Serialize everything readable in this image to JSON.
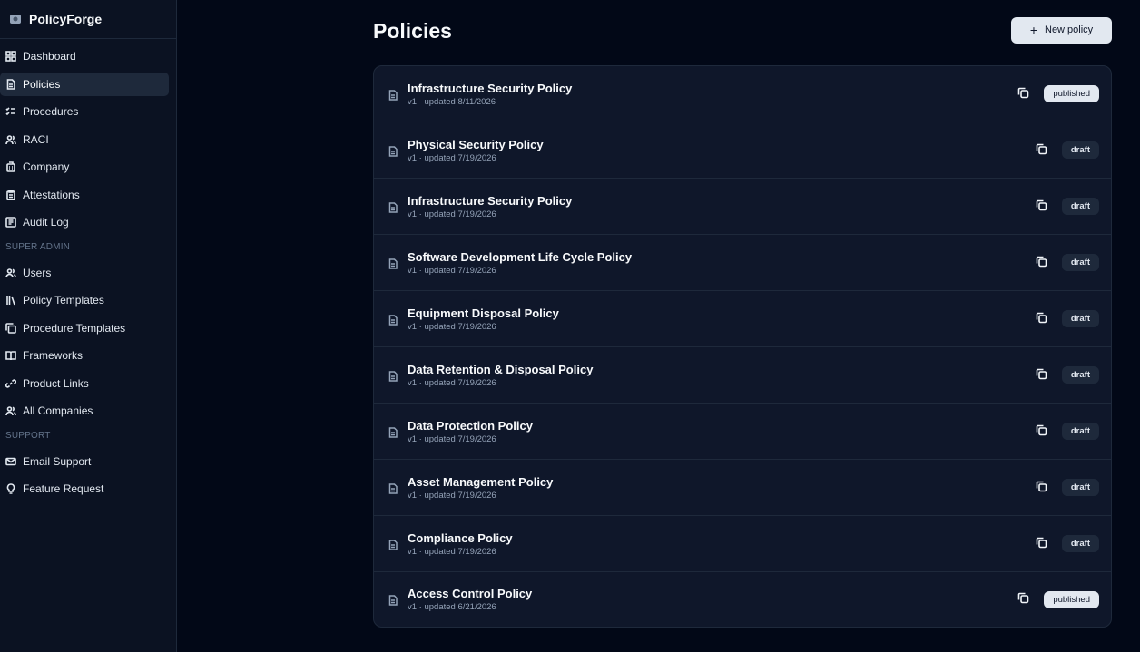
{
  "app": {
    "name": "PolicyForge"
  },
  "sidebar": {
    "items": [
      {
        "label": "Dashboard",
        "icon": "grid-icon",
        "active": false
      },
      {
        "label": "Policies",
        "icon": "document-icon",
        "active": true
      },
      {
        "label": "Procedures",
        "icon": "list-check-icon",
        "active": false
      },
      {
        "label": "RACI",
        "icon": "users-icon",
        "active": false
      },
      {
        "label": "Company",
        "icon": "building-icon",
        "active": false
      },
      {
        "label": "Attestations",
        "icon": "clipboard-icon",
        "active": false
      },
      {
        "label": "Audit Log",
        "icon": "log-icon",
        "active": false
      }
    ],
    "super_admin_label": "SUPER ADMIN",
    "super_admin_items": [
      {
        "label": "Users",
        "icon": "users-icon"
      },
      {
        "label": "Policy Templates",
        "icon": "library-icon"
      },
      {
        "label": "Procedure Templates",
        "icon": "copy-template-icon"
      },
      {
        "label": "Frameworks",
        "icon": "book-open-icon"
      },
      {
        "label": "Product Links",
        "icon": "link-icon"
      },
      {
        "label": "All Companies",
        "icon": "users-icon"
      }
    ],
    "support_label": "SUPPORT",
    "support_items": [
      {
        "label": "Email Support",
        "icon": "mail-icon"
      },
      {
        "label": "Feature Request",
        "icon": "lightbulb-icon"
      }
    ]
  },
  "main": {
    "title": "Policies",
    "new_button_label": "New policy",
    "policies": [
      {
        "title": "Infrastructure Security Policy",
        "meta": "v1 · updated 8/11/2026",
        "status": "published"
      },
      {
        "title": "Physical Security Policy",
        "meta": "v1 · updated 7/19/2026",
        "status": "draft"
      },
      {
        "title": "Infrastructure Security Policy",
        "meta": "v1 · updated 7/19/2026",
        "status": "draft"
      },
      {
        "title": "Software Development Life Cycle Policy",
        "meta": "v1 · updated 7/19/2026",
        "status": "draft"
      },
      {
        "title": "Equipment Disposal Policy",
        "meta": "v1 · updated 7/19/2026",
        "status": "draft"
      },
      {
        "title": "Data Retention & Disposal Policy",
        "meta": "v1 · updated 7/19/2026",
        "status": "draft"
      },
      {
        "title": "Data Protection Policy",
        "meta": "v1 · updated 7/19/2026",
        "status": "draft"
      },
      {
        "title": "Asset Management Policy",
        "meta": "v1 · updated 7/19/2026",
        "status": "draft"
      },
      {
        "title": "Compliance Policy",
        "meta": "v1 · updated 7/19/2026",
        "status": "draft"
      },
      {
        "title": "Access Control Policy",
        "meta": "v1 · updated 6/21/2026",
        "status": "published"
      }
    ]
  },
  "colors": {
    "background": "#020817",
    "sidebar": "#0b1222",
    "card": "#0f172a",
    "border": "#1e293b",
    "badge_published": "#e2e8f0",
    "badge_draft": "#1e293b"
  }
}
